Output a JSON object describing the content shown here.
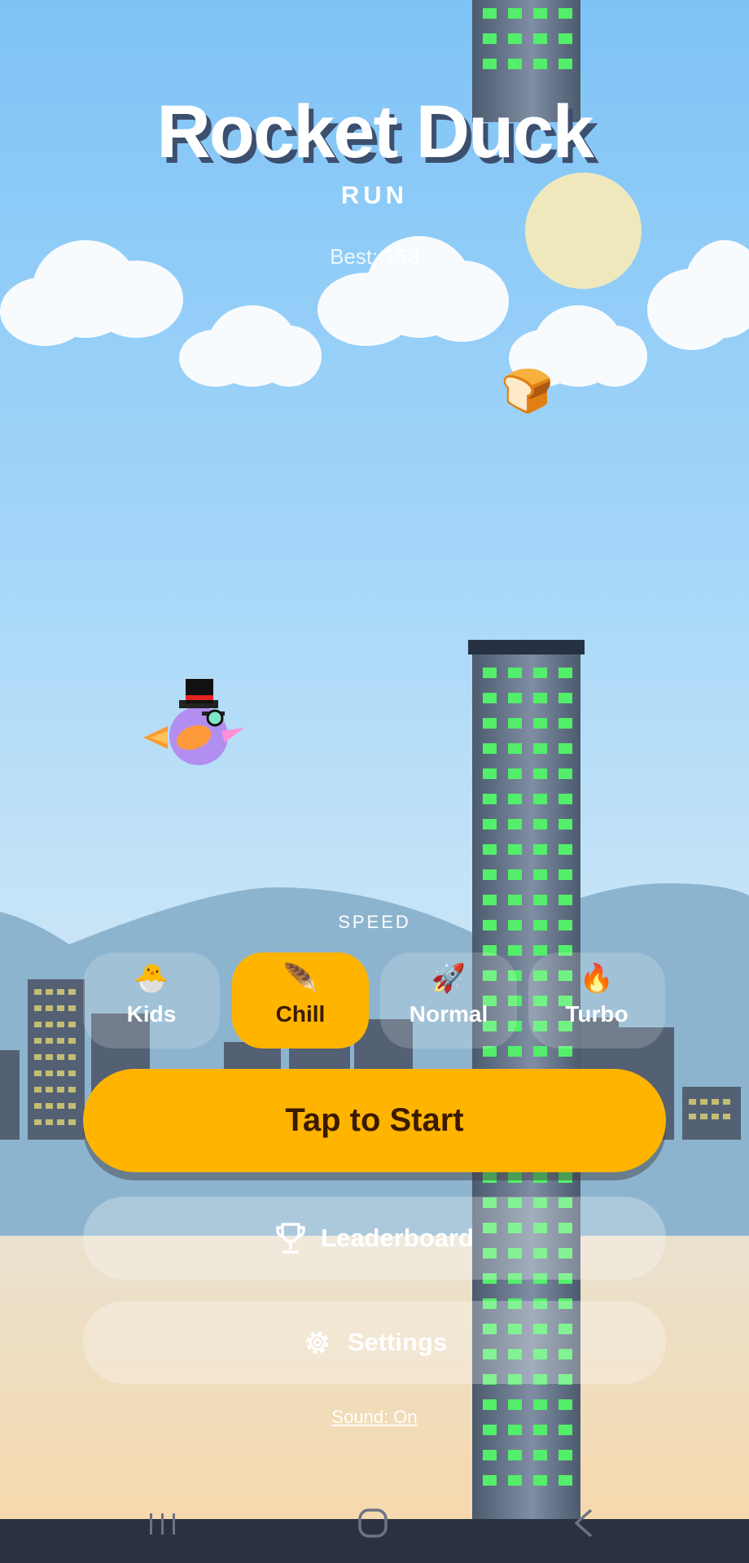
{
  "game": {
    "title": "Rocket Duck",
    "subtitle": "RUN",
    "best": "Best: 158"
  },
  "speed": {
    "label": "SPEED",
    "options": [
      {
        "label": "Kids",
        "emoji": "🐣",
        "selected": false
      },
      {
        "label": "Chill",
        "emoji": "🪶",
        "selected": true
      },
      {
        "label": "Normal",
        "emoji": "🚀",
        "selected": false
      },
      {
        "label": "Turbo",
        "emoji": "🔥",
        "selected": false
      }
    ]
  },
  "actions": {
    "start": "Tap to Start",
    "leaderboard": "Leaderboard",
    "settings": "Settings",
    "sound": "Sound: On"
  },
  "icons": {
    "pickup": "bread-icon",
    "player": "duck-with-top-hat",
    "leaderboard": "trophy-icon",
    "settings": "gear-icon",
    "nav": [
      "recent-apps-icon",
      "home-icon",
      "back-icon"
    ]
  },
  "colors": {
    "accent": "#ffb400",
    "tower_window": "#53ee6a",
    "sky": "#7ec3f6"
  }
}
